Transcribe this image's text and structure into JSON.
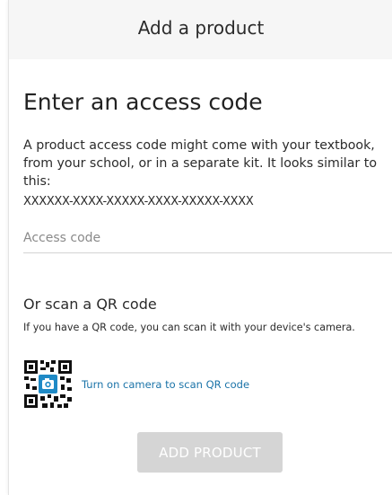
{
  "header": {
    "title": "Add a product"
  },
  "access_code": {
    "heading": "Enter an access code",
    "description": "A product access code might come with your textbook, from your school, or in a separate kit. It looks similar to this:",
    "sample_format": "XXXXXX-XXXX-XXXXX-XXXX-XXXXX-XXXX",
    "input_placeholder": "Access code",
    "input_value": ""
  },
  "qr": {
    "heading": "Or scan a QR code",
    "description": "If you have a QR code, you can scan it with your device's camera.",
    "icon": "qr-camera-icon",
    "link_label": "Turn on camera to scan QR code"
  },
  "actions": {
    "add_product_label": "ADD PRODUCT",
    "add_product_enabled": false
  },
  "colors": {
    "header_bg": "#f6f6f6",
    "link": "#1a73a8",
    "button_disabled_bg": "#d5d5d5",
    "camera_badge": "#1f8ac6"
  }
}
